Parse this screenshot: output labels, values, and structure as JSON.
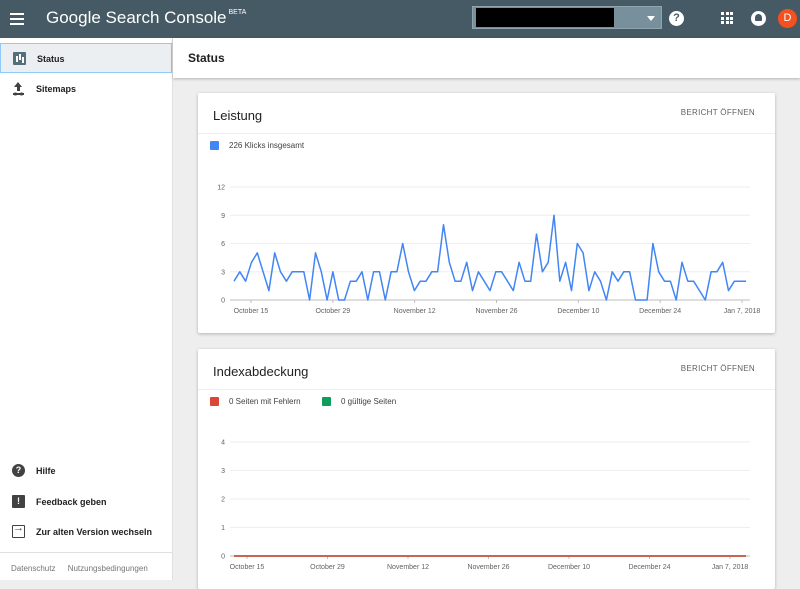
{
  "header": {
    "brand": "Google Search Console",
    "brand_badge": "BETA",
    "avatar_letter": "D",
    "help_glyph": "?"
  },
  "sidebar": {
    "items": [
      {
        "label": "Status",
        "icon": "status-chart-icon",
        "active": true
      },
      {
        "label": "Sitemaps",
        "icon": "upload-icon",
        "active": false
      }
    ],
    "bottom_items": [
      {
        "label": "Hilfe",
        "icon": "help-icon"
      },
      {
        "label": "Feedback geben",
        "icon": "feedback-icon"
      },
      {
        "label": "Zur alten Version wechseln",
        "icon": "exit-icon"
      }
    ],
    "footer": [
      "Datenschutz",
      "Nutzungsbedingungen"
    ]
  },
  "page": {
    "title": "Status"
  },
  "cards": {
    "performance": {
      "title": "Leistung",
      "link": "BERICHT ÖFFNEN",
      "legend": "226 Klicks insgesamt"
    },
    "index": {
      "title": "Indexabdeckung",
      "link": "BERICHT ÖFFNEN",
      "legend_errors": "0 Seiten mit Fehlern",
      "legend_valid": "0 gültige Seiten"
    }
  },
  "colors": {
    "clicks": "#4285f4",
    "errors": "#db4437",
    "valid": "#0f9d58",
    "topbar": "#455a64"
  },
  "chart_data": [
    {
      "type": "line",
      "x_tick_labels": [
        "October 15",
        "October 29",
        "November 12",
        "November 26",
        "December 10",
        "December 24",
        "Jan 7, 2018"
      ],
      "y_ticks": [
        0,
        3,
        6,
        9,
        12
      ],
      "ylim": [
        0,
        12
      ],
      "grid": true,
      "legend": "top-left",
      "series": [
        {
          "name": "226 Klicks insgesamt",
          "values": [
            2,
            3,
            2,
            4,
            5,
            3,
            1,
            5,
            3,
            2,
            3,
            3,
            3,
            0,
            5,
            3,
            0,
            3,
            0,
            0,
            2,
            2,
            3,
            0,
            3,
            3,
            0,
            3,
            3,
            6,
            3,
            1,
            2,
            2,
            3,
            3,
            8,
            4,
            2,
            2,
            4,
            1,
            3,
            2,
            1,
            3,
            3,
            2,
            1,
            4,
            2,
            2,
            7,
            3,
            4,
            9,
            2,
            4,
            1,
            6,
            5,
            1,
            3,
            2,
            0,
            3,
            2,
            3,
            3,
            0,
            0,
            0,
            6,
            3,
            2,
            2,
            0,
            4,
            2,
            2,
            1,
            0,
            3,
            3,
            4,
            1,
            2,
            2,
            2
          ]
        }
      ]
    },
    {
      "type": "line",
      "x_tick_labels": [
        "October 15",
        "October 29",
        "November 12",
        "November 26",
        "December 10",
        "December 24",
        "Jan 7, 2018"
      ],
      "y_ticks": [
        0,
        1,
        2,
        3,
        4
      ],
      "ylim": [
        0,
        4
      ],
      "grid": true,
      "legend": "top-left",
      "series": [
        {
          "name": "0 Seiten mit Fehlern",
          "values": [
            0,
            0
          ]
        },
        {
          "name": "0 gültige Seiten",
          "values": [
            0,
            0
          ]
        }
      ]
    }
  ]
}
